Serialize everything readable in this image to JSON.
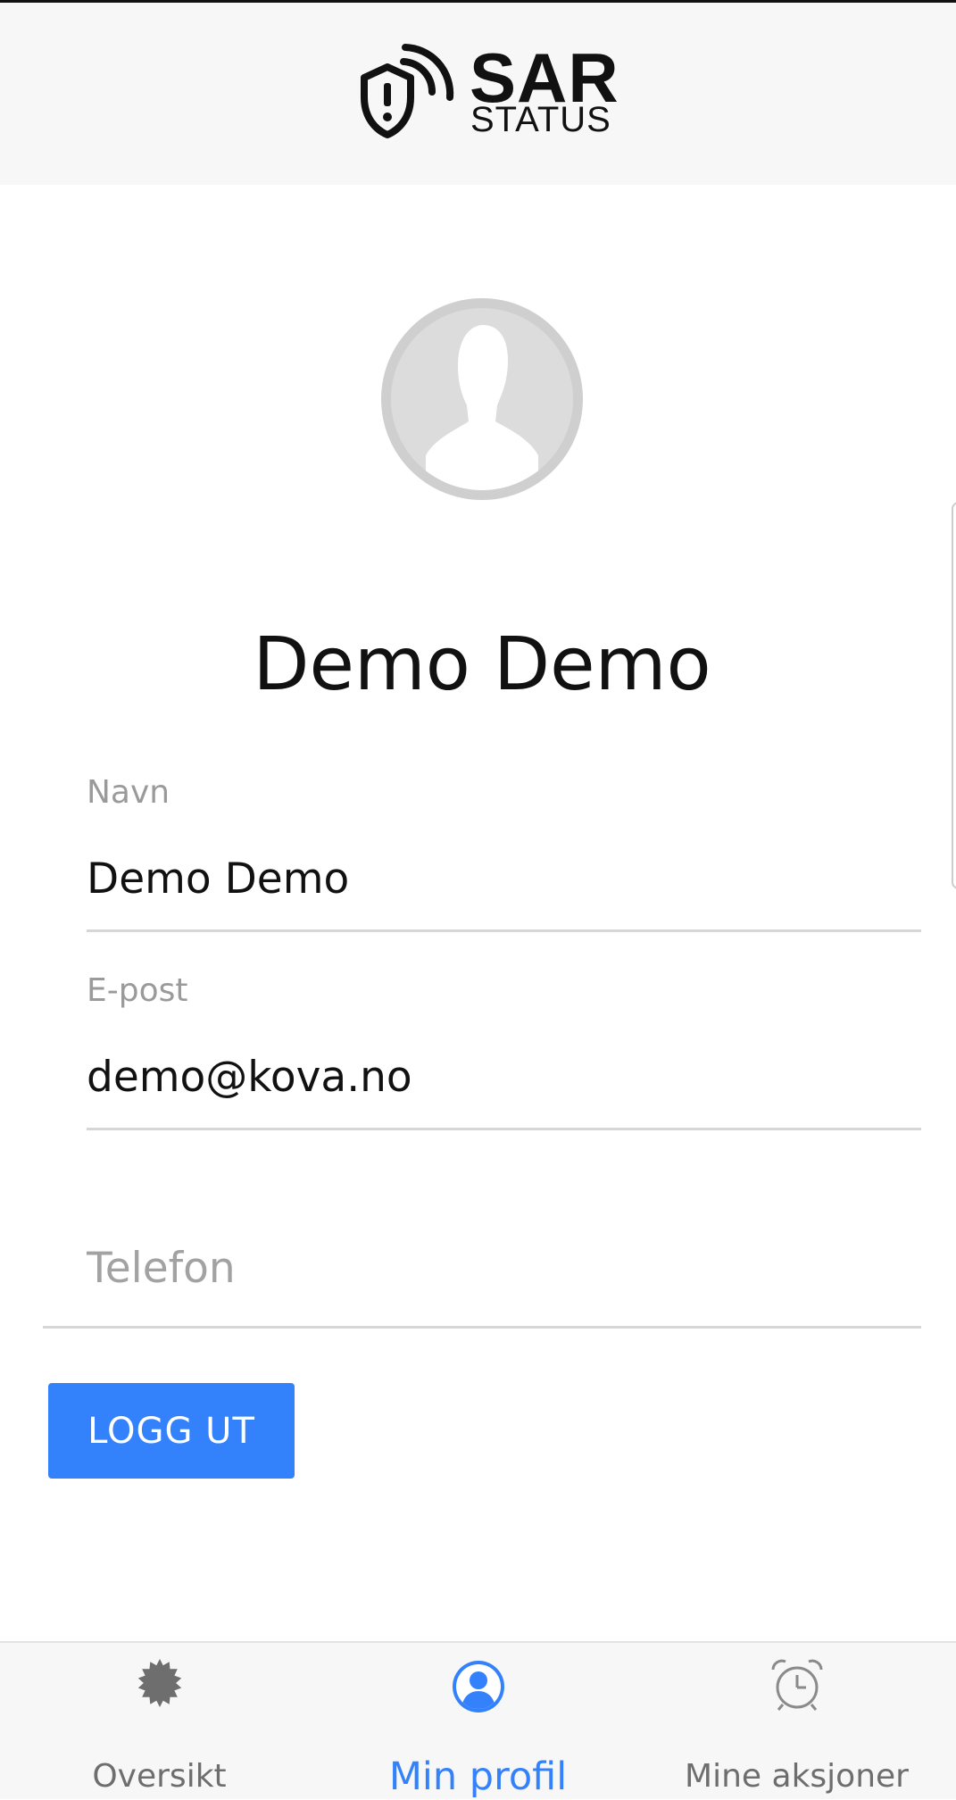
{
  "header": {
    "logo_primary": "SAR",
    "logo_secondary": "STATUS"
  },
  "profile": {
    "avatar_icon": "user-silhouette-icon",
    "display_name": "Demo Demo"
  },
  "fields": {
    "name": {
      "label": "Navn",
      "value": "Demo Demo"
    },
    "email": {
      "label": "E-post",
      "value": "demo@kova.no"
    },
    "phone": {
      "placeholder": "Telefon",
      "value": ""
    }
  },
  "actions": {
    "logout_label": "LOGG UT"
  },
  "bottom_nav": {
    "items": [
      {
        "label": "Oversikt",
        "icon": "gear-icon",
        "active": false
      },
      {
        "label": "Min profil",
        "icon": "user-circle-icon",
        "active": true
      },
      {
        "label": "Mine aksjoner",
        "icon": "alarm-clock-icon",
        "active": false
      }
    ]
  },
  "colors": {
    "accent": "#3482fb",
    "header_bg": "#f7f7f7",
    "muted_text": "#9a9a9a",
    "inactive_nav": "#6e6e6e"
  }
}
